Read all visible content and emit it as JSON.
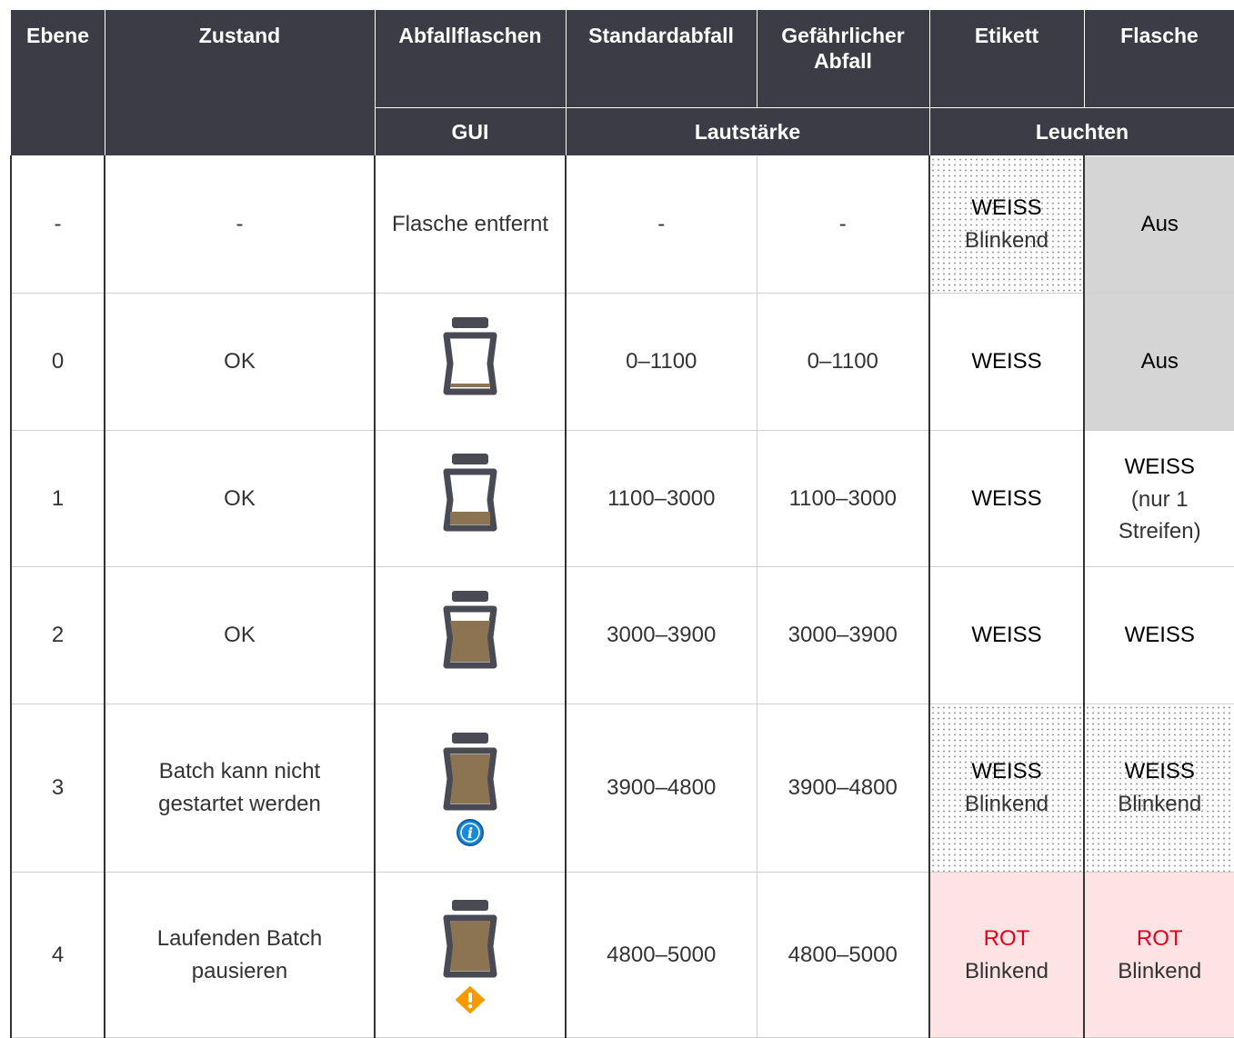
{
  "header": {
    "row1": [
      "Ebene",
      "Zustand",
      "Abfallflaschen",
      "Standardabfall",
      "Gefährlicher Abfall",
      "Etikett",
      "Flasche"
    ],
    "row2": {
      "gui": "GUI",
      "volume": "Lautstärke",
      "lights": "Leuchten"
    }
  },
  "rows": [
    {
      "level": "-",
      "state": "-",
      "gui_text": "Flasche entfernt",
      "gui_icon": "",
      "standard": "-",
      "hazardous": "-",
      "label_light": "WEISS",
      "label_mode": "Blinkend",
      "bottle_light": "Aus",
      "bottle_mode": ""
    },
    {
      "level": "0",
      "state": "OK",
      "gui_text": "",
      "gui_icon": "bottle-level-0-icon",
      "standard": "0–1100",
      "hazardous": "0–1100",
      "label_light": "WEISS",
      "label_mode": "",
      "bottle_light": "Aus",
      "bottle_mode": ""
    },
    {
      "level": "1",
      "state": "OK",
      "gui_text": "",
      "gui_icon": "bottle-level-1-icon",
      "standard": "1100–3000",
      "hazardous": "1100–3000",
      "label_light": "WEISS",
      "label_mode": "",
      "bottle_light": "WEISS",
      "bottle_mode": "(nur 1 Streifen)"
    },
    {
      "level": "2",
      "state": "OK",
      "gui_text": "",
      "gui_icon": "bottle-level-2-icon",
      "standard": "3000–3900",
      "hazardous": "3000–3900",
      "label_light": "WEISS",
      "label_mode": "",
      "bottle_light": "WEISS",
      "bottle_mode": ""
    },
    {
      "level": "3",
      "state": "Batch kann nicht gestartet werden",
      "gui_text": "",
      "gui_icon": "bottle-level-3-icon",
      "gui_badge": "info-icon",
      "standard": "3900–4800",
      "hazardous": "3900–4800",
      "label_light": "WEISS",
      "label_mode": "Blinkend",
      "bottle_light": "WEISS",
      "bottle_mode": "Blinkend"
    },
    {
      "level": "4",
      "state": "Laufenden Batch pausieren",
      "gui_text": "",
      "gui_icon": "bottle-level-4-icon",
      "gui_badge": "warning-icon",
      "standard": "4800–5000",
      "hazardous": "4800–5000",
      "label_light": "ROT",
      "label_mode": "Blinkend",
      "bottle_light": "ROT",
      "bottle_mode": "Blinkend"
    }
  ],
  "colors": {
    "header_bg": "#3c3c46",
    "off_bg": "#d5d5d5",
    "red_bg": "#fde3e3",
    "red_text": "#e4001c",
    "bottle_frame": "#4a4a54",
    "waste_fill": "#8c7452",
    "info_blue": "#1e88d8",
    "warning_orange": "#f59a00"
  }
}
